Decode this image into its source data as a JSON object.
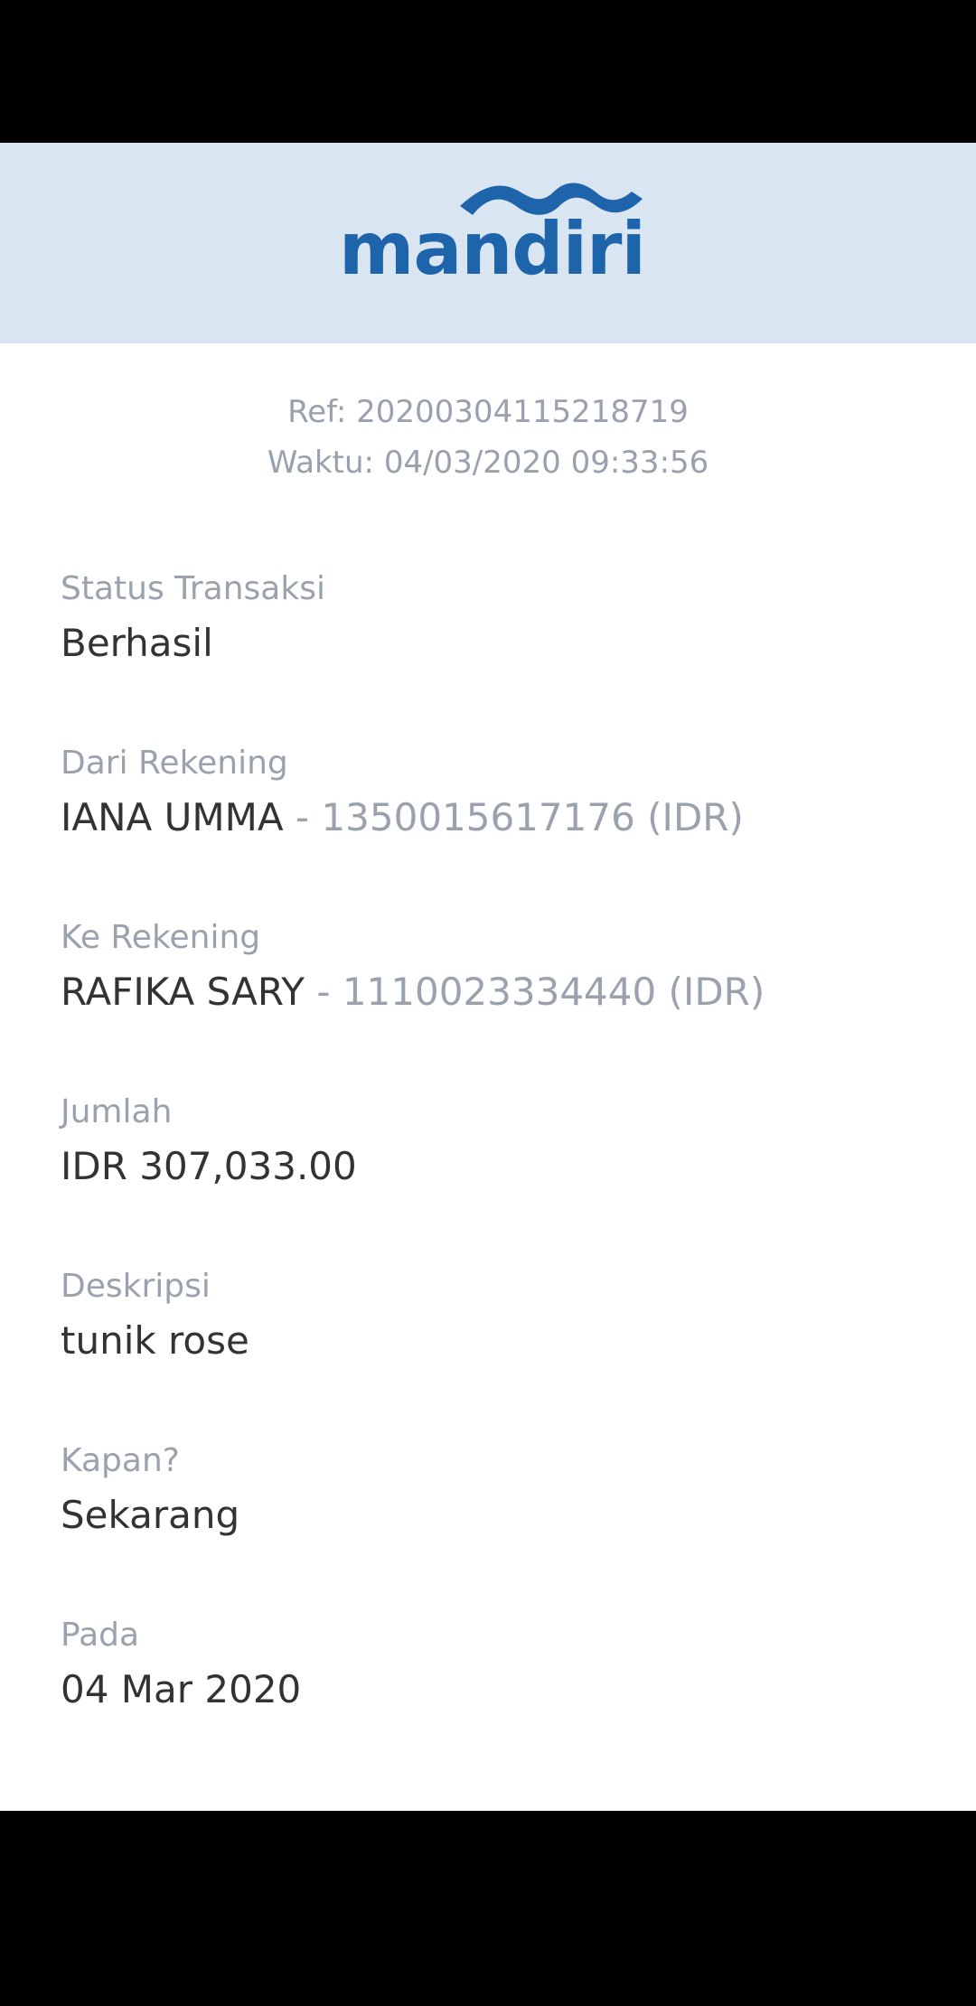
{
  "brand": {
    "logo_text": "mandiri",
    "color": "#1e64aa",
    "header_bg": "#d9e6f2"
  },
  "meta": {
    "ref": "Ref: 20200304115218719",
    "waktu": "Waktu: 04/03/2020 09:33:56"
  },
  "fields": {
    "status": {
      "label": "Status Transaksi",
      "value": "Berhasil"
    },
    "from": {
      "label": "Dari Rekening",
      "name": "IANA UMMA",
      "sep": " - ",
      "account": "1350015617176 (IDR)"
    },
    "to": {
      "label": "Ke Rekening",
      "name": "RAFIKA SARY",
      "sep": " - ",
      "account": "1110023334440 (IDR)"
    },
    "amount": {
      "label": "Jumlah",
      "value": "IDR 307,033.00"
    },
    "description": {
      "label": "Deskripsi",
      "value": "tunik rose"
    },
    "when": {
      "label": "Kapan?",
      "value": "Sekarang"
    },
    "date": {
      "label": "Pada",
      "value": "04 Mar 2020"
    }
  }
}
